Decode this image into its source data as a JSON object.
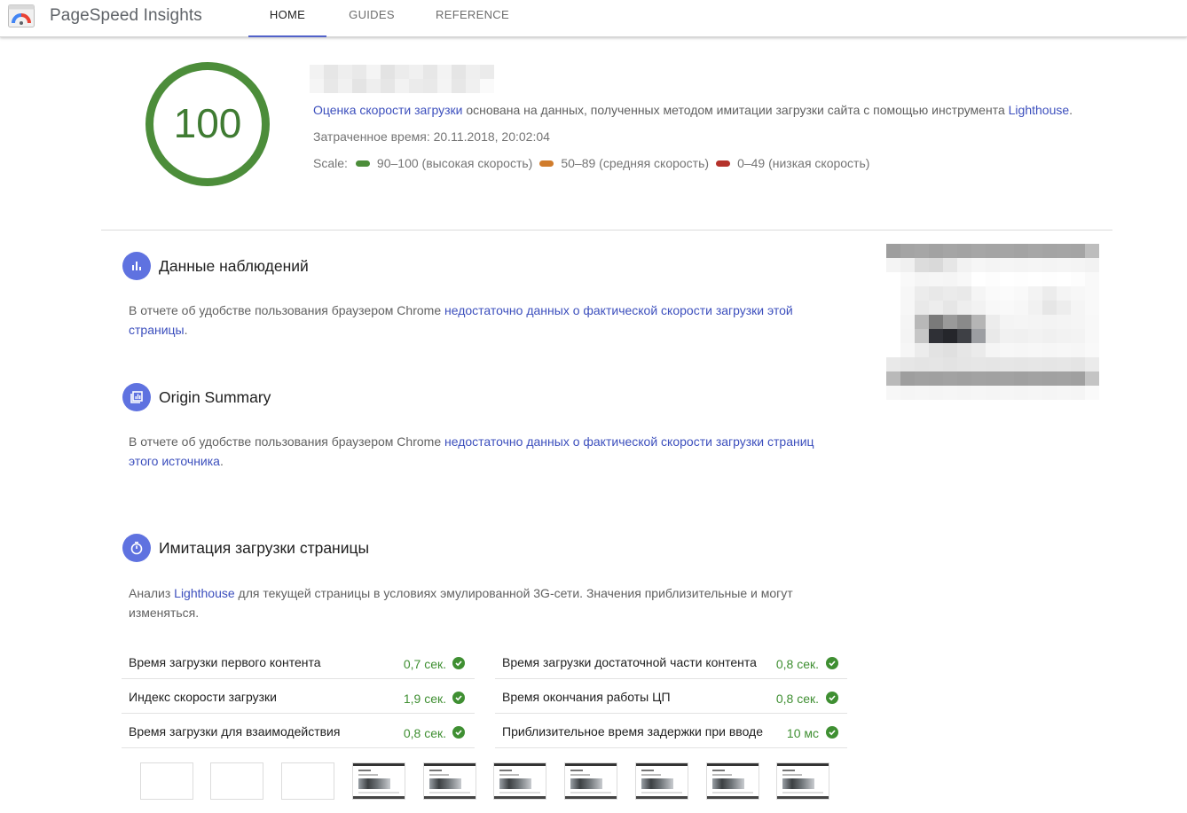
{
  "app": {
    "title": "PageSpeed Insights"
  },
  "nav": {
    "tabs": [
      {
        "label": "HOME"
      },
      {
        "label": "GUIDES"
      },
      {
        "label": "REFERENCE"
      }
    ]
  },
  "score": {
    "value": "100",
    "summary_link": "Оценка скорости загрузки",
    "summary_text": " основана на данных, полученных методом имитации загрузки сайта с помощью инструмента ",
    "summary_tool": "Lighthouse",
    "summary_end": ".",
    "elapsed": "Затраченное время: 20.11.2018, 20:02:04",
    "scale_label": "Scale:",
    "scale": [
      {
        "label": "90–100 (высокая скорость)",
        "color": "#4c8d3a"
      },
      {
        "label": "50–89 (средняя скорость)",
        "color": "#d07c2c"
      },
      {
        "label": "0–49 (низкая скорость)",
        "color": "#b5322b"
      }
    ]
  },
  "field_data": {
    "title": "Данные наблюдений",
    "text": "В отчете об удобстве пользования браузером Chrome ",
    "link": "недостаточно данных о фактической скорости загрузки этой страницы",
    "end": "."
  },
  "origin_summary": {
    "title": "Origin Summary",
    "text": "В отчете об удобстве пользования браузером Chrome ",
    "link": "недостаточно данных о фактической скорости загрузки страниц этого источника",
    "end": "."
  },
  "lab_data": {
    "title": "Имитация загрузки страницы",
    "text_start": "Анализ ",
    "link": "Lighthouse",
    "text_end": " для текущей страницы в условиях эмулированной 3G-сети. Значения приблизительные и могут изменяться."
  },
  "metrics": [
    {
      "label": "Время загрузки первого контента",
      "value": "0,7 сек."
    },
    {
      "label": "Время загрузки достаточной части контента",
      "value": "0,8 сек."
    },
    {
      "label": "Индекс скорости загрузки",
      "value": "1,9 сек."
    },
    {
      "label": "Время окончания работы ЦП",
      "value": "0,8 сек."
    },
    {
      "label": "Время загрузки для взаимодействия",
      "value": "0,8 сек."
    },
    {
      "label": "Приблизительное время задержки при вводе",
      "value": "10 мс"
    }
  ],
  "colors": {
    "accent": "#5262c9",
    "pass": "#3f8f32",
    "link": "#3c4fbd",
    "section_icon": "#5f72e0"
  },
  "icons": {
    "field_data": "bar-chart-icon",
    "origin_summary": "library-chart-icon",
    "lab_data": "timer-icon",
    "pass": "check-circle-icon"
  }
}
